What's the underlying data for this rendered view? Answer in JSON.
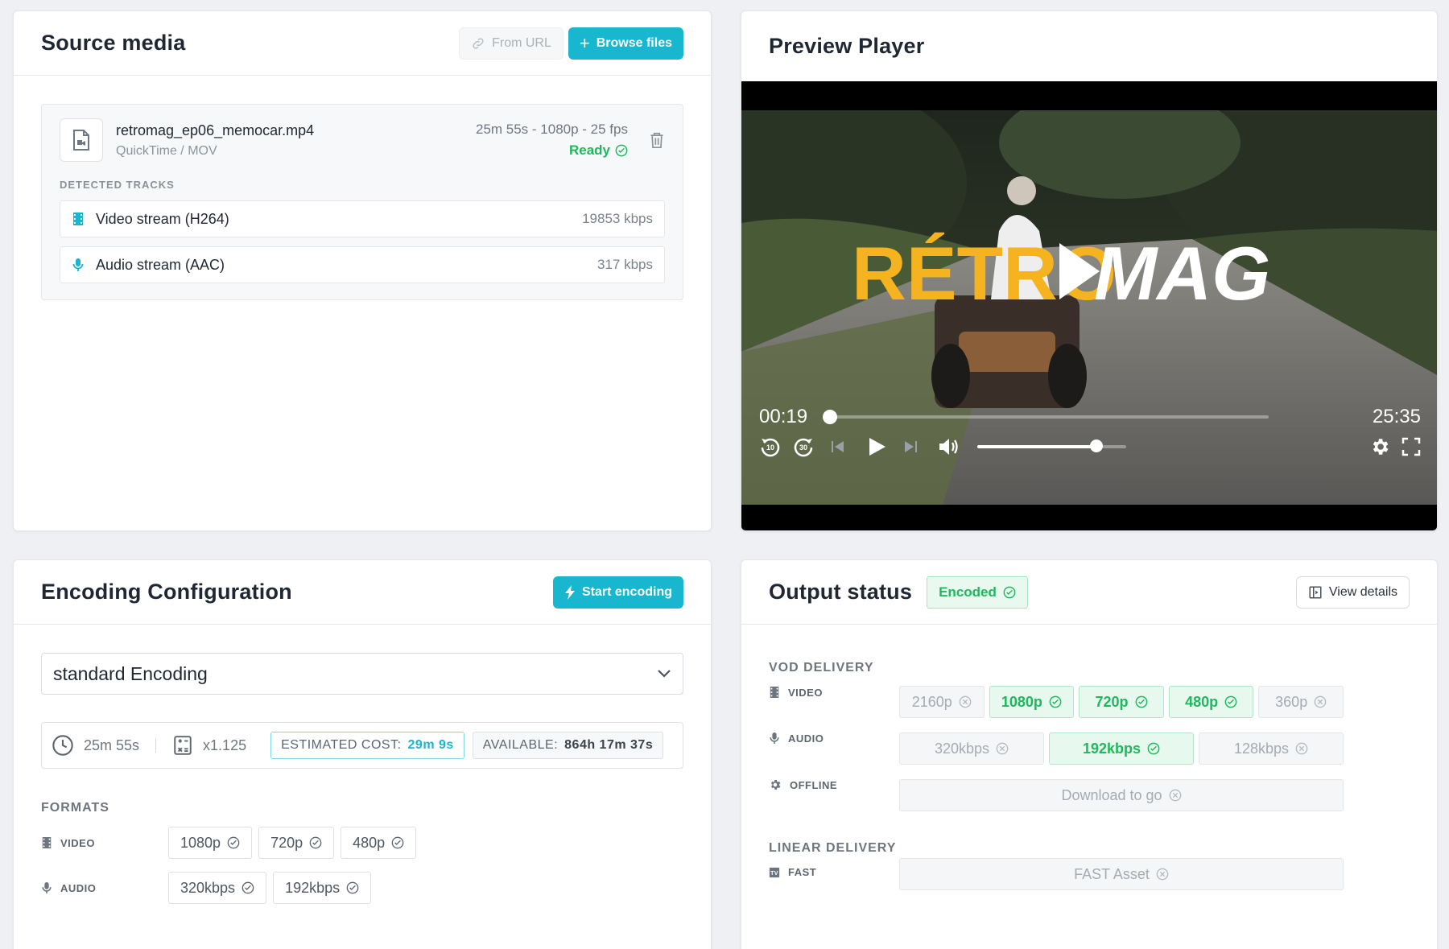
{
  "source": {
    "title": "Source media",
    "from_url_label": "From URL",
    "browse_label": "Browse files",
    "file": {
      "name": "retromag_ep06_memocar.mp4",
      "type": "QuickTime / MOV",
      "meta": "25m 55s - 1080p - 25 fps",
      "status": "Ready"
    },
    "tracks_label": "DETECTED TRACKS",
    "tracks": [
      {
        "name": "Video stream (H264)",
        "rate": "19853 kbps",
        "icon": "film-icon"
      },
      {
        "name": "Audio stream (AAC)",
        "rate": "317 kbps",
        "icon": "mic-icon"
      }
    ]
  },
  "preview": {
    "title": "Preview Player",
    "logo_text": "RÉTROMAG",
    "current_time": "00:19",
    "duration": "25:35",
    "progress_fraction": 0.012,
    "volume_fraction": 0.8
  },
  "encoding": {
    "title": "Encoding Configuration",
    "start_label": "Start encoding",
    "preset": "standard Encoding",
    "duration": "25m 55s",
    "multiplier": "x1.125",
    "estimated_cost_label": "ESTIMATED COST:",
    "estimated_cost_value": "29m 9s",
    "available_label": "AVAILABLE:",
    "available_value": "864h 17m 37s",
    "formats_label": "FORMATS",
    "video_label": "VIDEO",
    "audio_label": "AUDIO",
    "video_formats": [
      "1080p",
      "720p",
      "480p"
    ],
    "audio_formats": [
      "320kbps",
      "192kbps"
    ]
  },
  "output": {
    "title": "Output status",
    "status_badge": "Encoded",
    "view_details_label": "View details",
    "vod_label": "VOD DELIVERY",
    "video_label": "VIDEO",
    "audio_label": "AUDIO",
    "offline_label": "OFFLINE",
    "video": [
      {
        "label": "2160p",
        "done": false
      },
      {
        "label": "1080p",
        "done": true
      },
      {
        "label": "720p",
        "done": true
      },
      {
        "label": "480p",
        "done": true
      },
      {
        "label": "360p",
        "done": false
      }
    ],
    "audio": [
      {
        "label": "320kbps",
        "done": false
      },
      {
        "label": "192kbps",
        "done": true
      },
      {
        "label": "128kbps",
        "done": false
      }
    ],
    "offline": {
      "label": "Download to go",
      "done": false
    },
    "linear_label": "LINEAR DELIVERY",
    "fast_label": "FAST",
    "fast": {
      "label": "FAST Asset",
      "done": false
    }
  },
  "colors": {
    "accent": "#19b6cf",
    "success": "#1fb85c",
    "logo_yellow": "#f5b320"
  }
}
